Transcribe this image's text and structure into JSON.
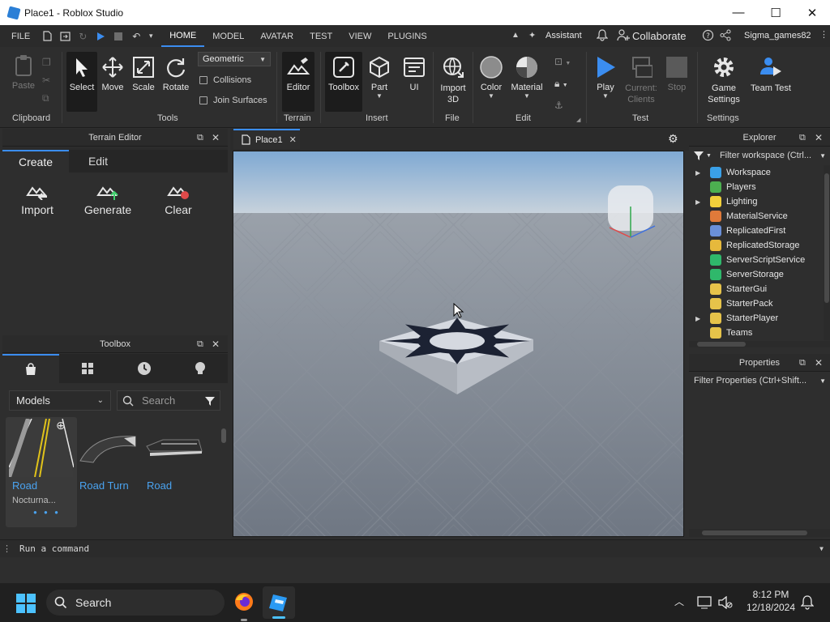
{
  "window": {
    "title": "Place1 - Roblox Studio",
    "minimize_glyph": "—",
    "maximize_glyph": "☐",
    "close_glyph": "✕"
  },
  "menubar": {
    "file": "FILE",
    "tabs": [
      "HOME",
      "MODEL",
      "AVATAR",
      "TEST",
      "VIEW",
      "PLUGINS"
    ],
    "active_tab": "HOME",
    "assistant": "Assistant",
    "collaborate": "Collaborate",
    "username": "Sigma_games82"
  },
  "ribbon": {
    "clipboard": {
      "paste": "Paste",
      "label": "Clipboard"
    },
    "tools": {
      "select": "Select",
      "move": "Move",
      "scale": "Scale",
      "rotate": "Rotate",
      "mode": "Geometric",
      "collisions": "Collisions",
      "join_surfaces": "Join Surfaces",
      "label": "Tools"
    },
    "terrain": {
      "editor": "Editor",
      "label": "Terrain"
    },
    "insert": {
      "toolbox": "Toolbox",
      "part": "Part",
      "ui": "UI",
      "label": "Insert"
    },
    "file": {
      "import3d": "Import 3D",
      "label": "File"
    },
    "edit": {
      "color": "Color",
      "material": "Material",
      "label": "Edit"
    },
    "test": {
      "play": "Play",
      "current_clients": "Current: Clients",
      "stop": "Stop",
      "label": "Test"
    },
    "settings": {
      "game_settings": "Game Settings",
      "team_test": "Team Test",
      "label": "Settings"
    }
  },
  "terrain_editor": {
    "title": "Terrain Editor",
    "tabs": [
      "Create",
      "Edit"
    ],
    "active_tab": "Create",
    "actions": [
      "Import",
      "Generate",
      "Clear"
    ]
  },
  "toolbox": {
    "title": "Toolbox",
    "category": "Models",
    "search_placeholder": "Search",
    "items": [
      {
        "name": "Road",
        "creator": "Nocturna..."
      },
      {
        "name": "Road Turn",
        "creator": ""
      },
      {
        "name": "Road",
        "creator": ""
      }
    ]
  },
  "viewport": {
    "tab": "Place1"
  },
  "explorer": {
    "title": "Explorer",
    "filter_placeholder": "Filter workspace (Ctrl...",
    "items": [
      {
        "name": "Workspace",
        "expandable": true,
        "color": "#3aa0e8"
      },
      {
        "name": "Players",
        "expandable": false,
        "color": "#4caf50"
      },
      {
        "name": "Lighting",
        "expandable": true,
        "color": "#f2d03b"
      },
      {
        "name": "MaterialService",
        "expandable": false,
        "color": "#e07a3a"
      },
      {
        "name": "ReplicatedFirst",
        "expandable": false,
        "color": "#6a8fd8"
      },
      {
        "name": "ReplicatedStorage",
        "expandable": false,
        "color": "#e6b93c"
      },
      {
        "name": "ServerScriptService",
        "expandable": false,
        "color": "#2fb86b"
      },
      {
        "name": "ServerStorage",
        "expandable": false,
        "color": "#2fb86b"
      },
      {
        "name": "StarterGui",
        "expandable": false,
        "color": "#e6c34a"
      },
      {
        "name": "StarterPack",
        "expandable": false,
        "color": "#e6c34a"
      },
      {
        "name": "StarterPlayer",
        "expandable": true,
        "color": "#e6c34a"
      },
      {
        "name": "Teams",
        "expandable": false,
        "color": "#e6c34a"
      }
    ]
  },
  "properties": {
    "title": "Properties",
    "filter_placeholder": "Filter Properties (Ctrl+Shift..."
  },
  "command_bar": {
    "placeholder": "Run a command"
  },
  "taskbar": {
    "search": "Search",
    "time": "8:12 PM",
    "date": "12/18/2024"
  },
  "colors": {
    "accent": "#3b8df0",
    "link": "#4aa3f0",
    "sky_top": "#7fa9d3",
    "ground": "#7b838f"
  }
}
